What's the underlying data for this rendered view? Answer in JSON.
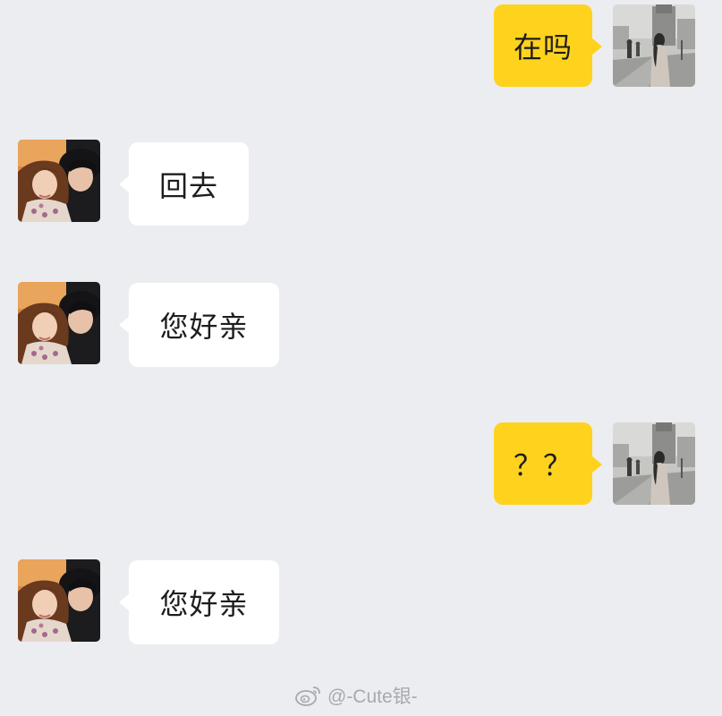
{
  "messages": [
    {
      "side": "out",
      "text": "在吗",
      "avatar": "street-photo-avatar-icon"
    },
    {
      "side": "in",
      "text": "回去",
      "avatar": "couple-photo-avatar-icon"
    },
    {
      "side": "in",
      "text": "您好亲",
      "avatar": "couple-photo-avatar-icon"
    },
    {
      "side": "out",
      "text": "？？",
      "avatar": "street-photo-avatar-icon"
    },
    {
      "side": "in",
      "text": "您好亲",
      "avatar": "couple-photo-avatar-icon"
    }
  ],
  "watermark": {
    "icon": "weibo-icon",
    "text": "@-Cute银-"
  },
  "colors": {
    "background": "#ecedf1",
    "outgoing_bubble": "#ffd21e",
    "incoming_bubble": "#ffffff"
  }
}
